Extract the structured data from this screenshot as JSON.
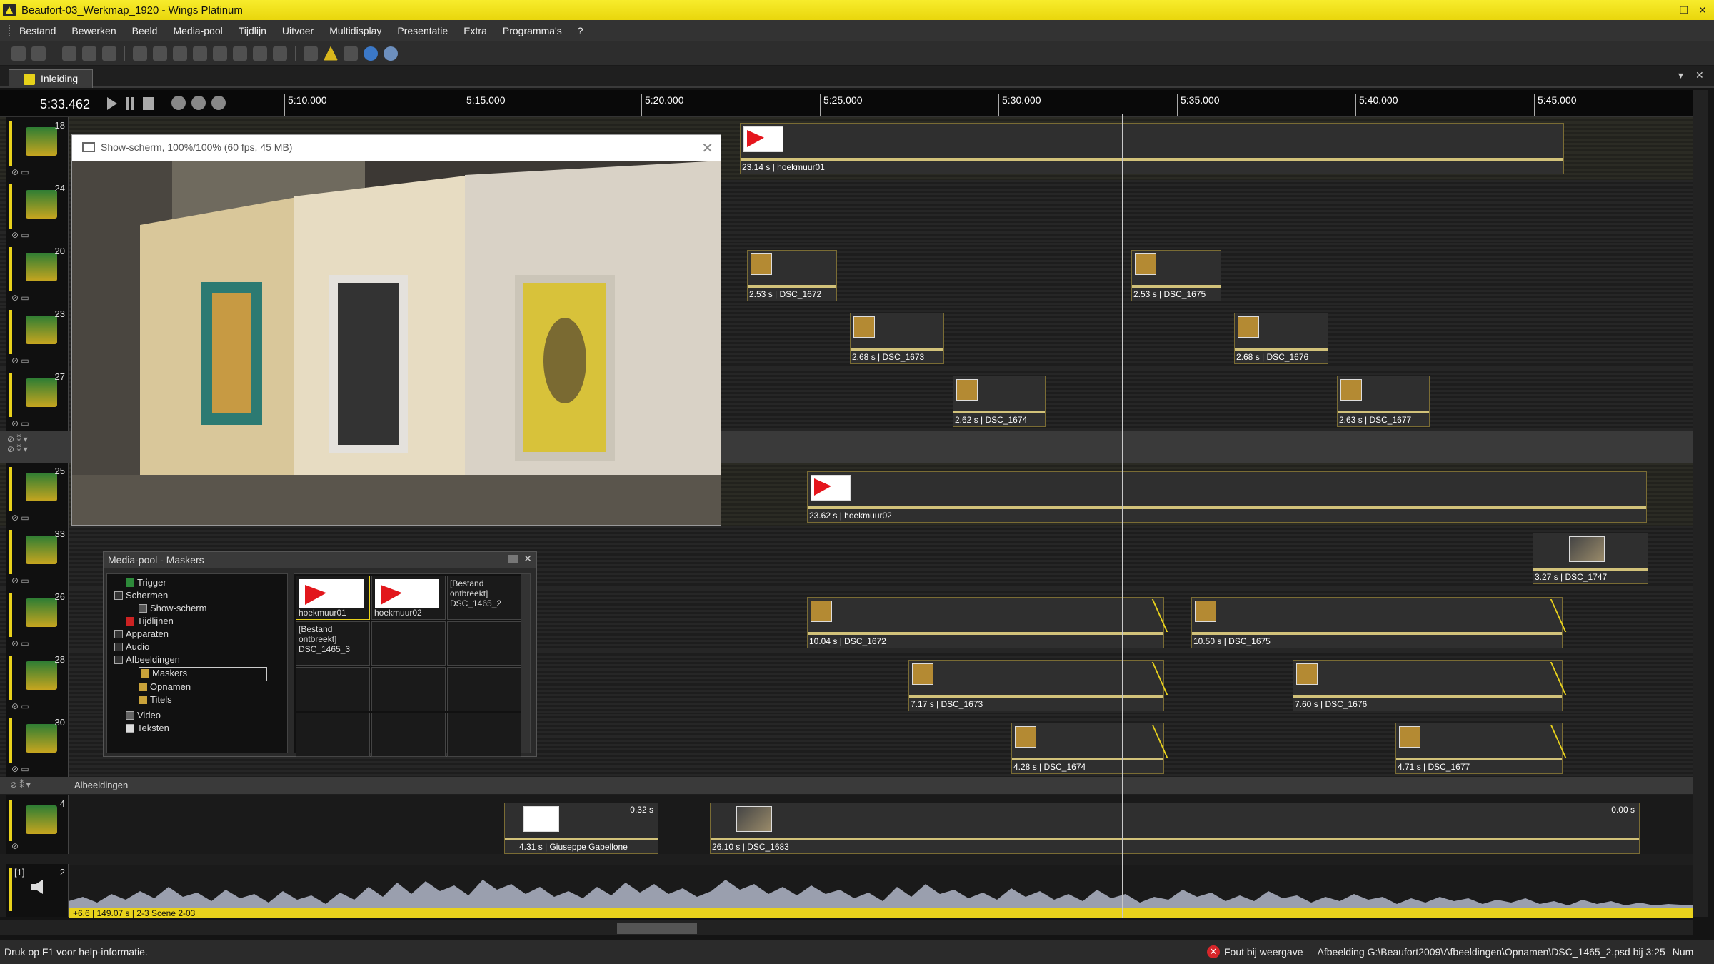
{
  "window": {
    "title": "Beaufort-03_Werkmap_1920 - Wings Platinum",
    "minimize": "–",
    "restore": "❐",
    "close": "✕"
  },
  "menu": [
    "Bestand",
    "Bewerken",
    "Beeld",
    "Media-pool",
    "Tijdlijn",
    "Uitvoer",
    "Multidisplay",
    "Presentatie",
    "Extra",
    "Programma's",
    "?"
  ],
  "tab": {
    "label": "Inleiding",
    "dropdown": "▾",
    "close": "✕"
  },
  "timeline": {
    "timecode": "5:33.462",
    "ticks": [
      "5:10.000",
      "5:15.000",
      "5:20.000",
      "5:25.000",
      "5:30.000",
      "5:35.000",
      "5:40.000",
      "5:45.000"
    ]
  },
  "tracks": [
    {
      "num": "18",
      "clips": [
        {
          "label": "23.14 s | hoekmuur01"
        }
      ]
    },
    {
      "num": "24",
      "clips": []
    },
    {
      "num": "20",
      "clips": [
        {
          "label": "2.53 s | DSC_1672"
        },
        {
          "label": "2.53 s | DSC_1675"
        }
      ]
    },
    {
      "num": "23",
      "clips": [
        {
          "label": "2.68 s | DSC_1673"
        },
        {
          "label": "2.68 s | DSC_1676"
        }
      ]
    },
    {
      "num": "27",
      "clips": [
        {
          "label": "2.62 s | DSC_1674"
        },
        {
          "label": "2.63 s | DSC_1677"
        }
      ]
    },
    {
      "num": "25",
      "clips": [
        {
          "label": "23.62 s | hoekmuur02"
        }
      ]
    },
    {
      "num": "33",
      "clips": [
        {
          "label": "3.27 s | DSC_1747"
        }
      ]
    },
    {
      "num": "26",
      "clips": [
        {
          "label": "10.04 s | DSC_1672"
        },
        {
          "label": "10.50 s | DSC_1675"
        }
      ]
    },
    {
      "num": "28",
      "clips": [
        {
          "label": "7.17 s | DSC_1673"
        },
        {
          "label": "7.60 s | DSC_1676"
        }
      ]
    },
    {
      "num": "30",
      "clips": [
        {
          "label": "4.28 s | DSC_1674"
        },
        {
          "label": "4.71 s | DSC_1677"
        }
      ]
    }
  ],
  "group_label": "Albeeldingen",
  "bottom_track": {
    "num": "4",
    "clips": [
      {
        "label": "4.31 s | Giuseppe Gabellone",
        "sv": "0.32 s"
      },
      {
        "label": "26.10 s | DSC_1683",
        "sv": "0.00 s"
      }
    ]
  },
  "audio_track": {
    "num": "2",
    "id": "[1]",
    "info": "+6.6 | 149.07 s | 2-3 Scene 2-03"
  },
  "show_window": {
    "title": "Show-scherm, 100%/100% (60 fps, 45 MB)",
    "close": "✕"
  },
  "media_pool": {
    "title": "Media-pool - Maskers",
    "tree": [
      "Trigger",
      "Schermen",
      "Show-scherm",
      "Tijdlijnen",
      "Apparaten",
      "Audio",
      "Afbeeldingen",
      "Maskers",
      "Opnamen",
      "Titels",
      "Video",
      "Teksten"
    ],
    "cells": [
      {
        "label": "hoekmuur01",
        "kind": "img"
      },
      {
        "label": "hoekmuur02",
        "kind": "img"
      },
      {
        "label": "[Bestand ontbreekt] DSC_1465_2",
        "kind": "missing"
      },
      {
        "label": "[Bestand ontbreekt] DSC_1465_3",
        "kind": "missing"
      }
    ]
  },
  "status": {
    "help": "Druk op F1 voor help-informatie.",
    "error": "Fout bij weergave",
    "path": "Afbeelding G:\\Beaufort2009\\Afbeeldingen\\Opnamen\\DSC_1465_2.psd bij 3:25",
    "mode": "Num"
  },
  "colors": {
    "accent": "#e9d21c",
    "background": "#1e1e1e",
    "error": "#d8262a"
  }
}
